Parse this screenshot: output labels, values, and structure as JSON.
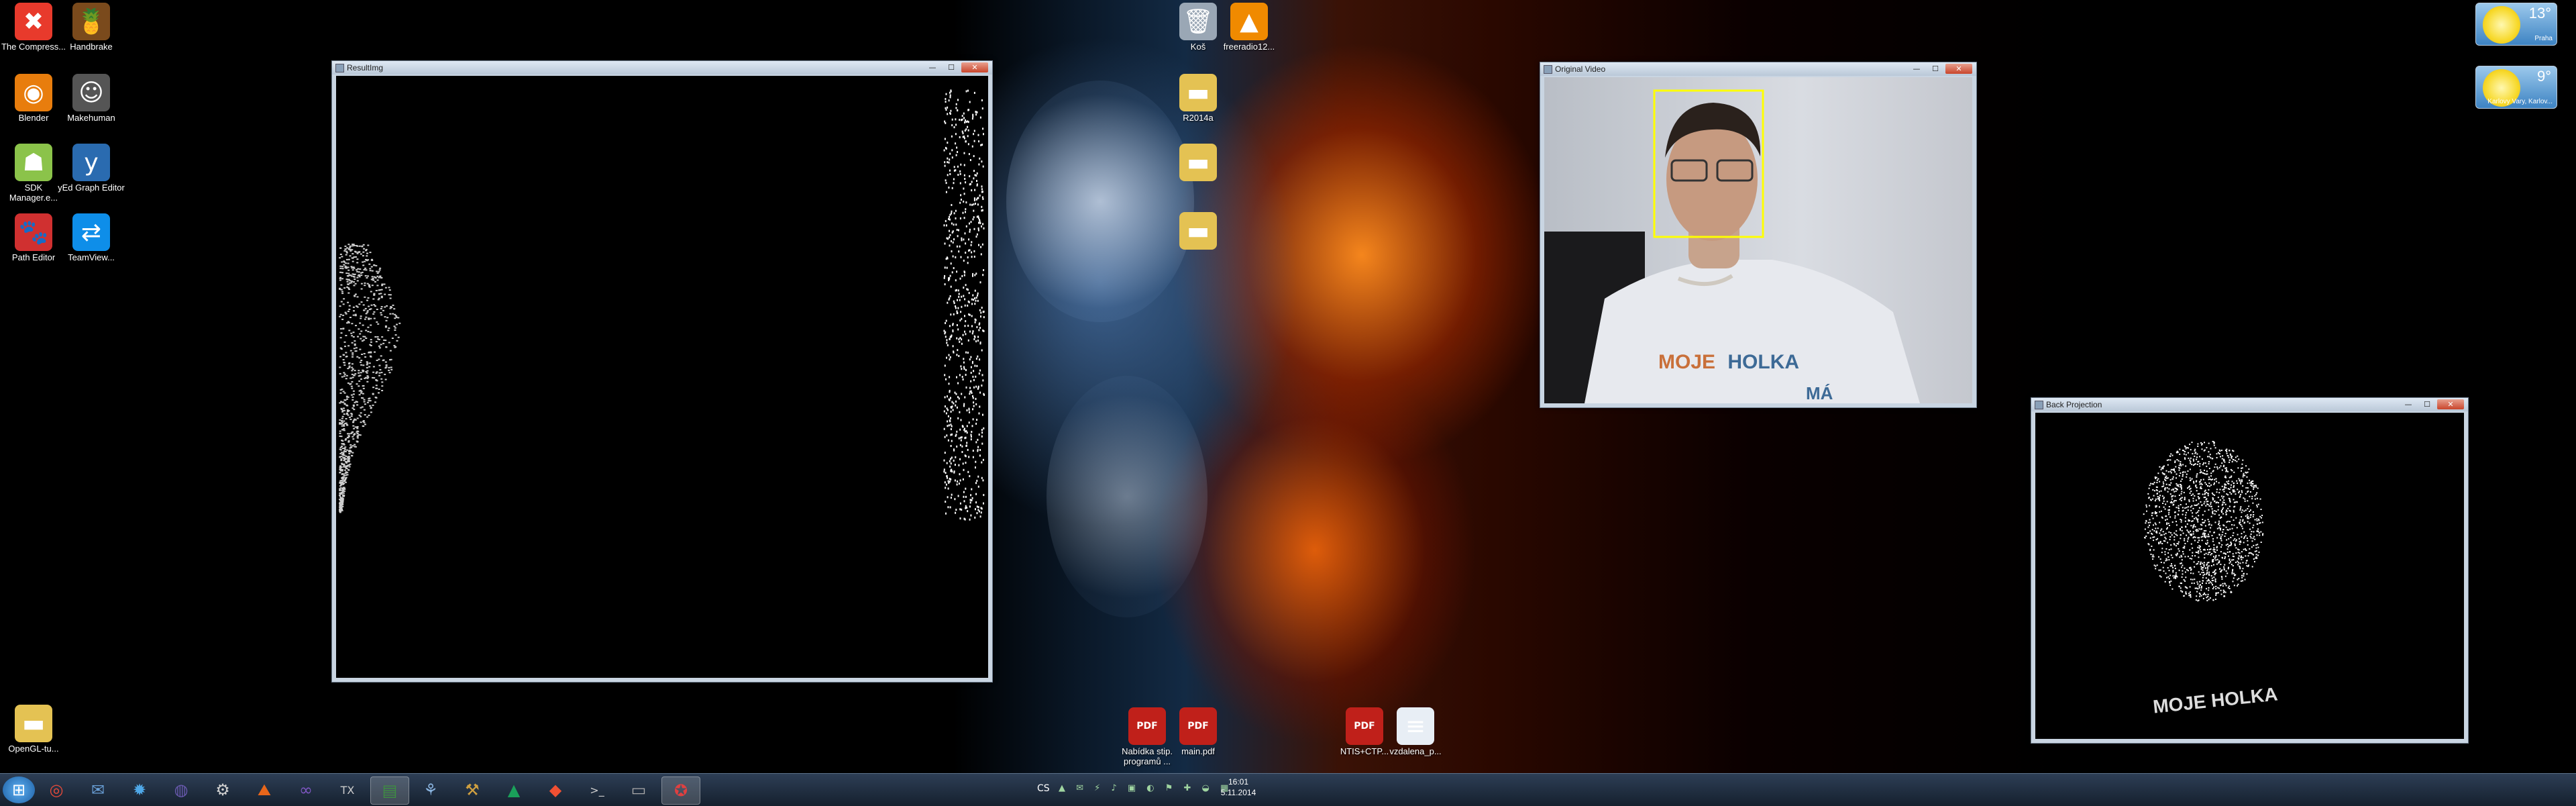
{
  "desktop_icons_left": [
    {
      "label": "The Compress...",
      "icon": "compress-icon",
      "color": "#e83a2c",
      "glyph": "✖"
    },
    {
      "label": "Handbrake",
      "icon": "handbrake-icon",
      "color": "#7a4a1c",
      "glyph": "🍍"
    },
    {
      "label": "Blender",
      "icon": "blender-icon",
      "color": "#e87d0d",
      "glyph": "◉"
    },
    {
      "label": "Makehuman",
      "icon": "makehuman-icon",
      "color": "#555555",
      "glyph": "☺"
    },
    {
      "label": "SDK Manager.e...",
      "icon": "android-sdk-icon",
      "color": "#8bc34a",
      "glyph": "☗"
    },
    {
      "label": "yEd Graph Editor",
      "icon": "yed-icon",
      "color": "#2a6bb0",
      "glyph": "y"
    },
    {
      "label": "Path Editor",
      "icon": "path-editor-icon",
      "color": "#d03030",
      "glyph": "🐾"
    },
    {
      "label": "TeamView...",
      "icon": "teamviewer-icon",
      "color": "#0e8ee9",
      "glyph": "⇄"
    },
    {
      "label": "OpenGL-tu...",
      "icon": "folder-icon",
      "color": "#e4c253",
      "glyph": "▬"
    }
  ],
  "desktop_icons_center": [
    {
      "label": "Koš",
      "icon": "recycle-bin-icon",
      "color": "#9aa7b5",
      "glyph": "🗑"
    },
    {
      "label": "freeradio12...",
      "icon": "vlc-icon",
      "color": "#f08a00",
      "glyph": "▲"
    },
    {
      "label": "R2014a",
      "icon": "folder-icon",
      "color": "#e4c253",
      "glyph": "▬"
    },
    {
      "label": "",
      "icon": "folder-icon",
      "color": "#e4c253",
      "glyph": "▬"
    },
    {
      "label": "",
      "icon": "folder-icon",
      "color": "#e4c253",
      "glyph": "▬"
    }
  ],
  "desktop_icons_bottom": [
    {
      "label": "Nabídka stip. programů ...",
      "icon": "pdf-icon",
      "color": "#c0201a",
      "glyph": "PDF"
    },
    {
      "label": "main.pdf",
      "icon": "pdf-icon",
      "color": "#c0201a",
      "glyph": "PDF"
    },
    {
      "label": "NTIS+CTP...",
      "icon": "pdf-icon",
      "color": "#c0201a",
      "glyph": "PDF"
    },
    {
      "label": "vzdalena_p...",
      "icon": "text-file-icon",
      "color": "#e8eef5",
      "glyph": "≡"
    }
  ],
  "windows": {
    "result": {
      "title": "ResultImg"
    },
    "original": {
      "title": "Original Video",
      "overlay_text": [
        "MOJE",
        "HOLKA",
        "MÁ"
      ]
    },
    "backproj": {
      "title": "Back Projection",
      "overlay_text": "MOJE HOLKA"
    }
  },
  "window_buttons": {
    "minimize": "—",
    "maximize": "☐",
    "close": "✕"
  },
  "gadgets": [
    {
      "temp": "13°",
      "city": "Praha"
    },
    {
      "temp": "9°",
      "city": "Karlovy Vary, Karlov..."
    }
  ],
  "taskbar": {
    "start_glyph": "⊞",
    "apps": [
      {
        "icon": "chrome-icon",
        "glyph": "◎",
        "color": "#e44a3a"
      },
      {
        "icon": "email-icon",
        "glyph": "✉",
        "color": "#6aa0d8"
      },
      {
        "icon": "browser-icon",
        "glyph": "✹",
        "color": "#4fa8e8"
      },
      {
        "icon": "eclipse-icon",
        "glyph": "◍",
        "color": "#6a5ab0"
      },
      {
        "icon": "settings-app-icon",
        "glyph": "⚙",
        "color": "#d0d0d0"
      },
      {
        "icon": "matlab-icon",
        "glyph": "⛰",
        "color": "#e8661a"
      },
      {
        "icon": "visual-studio-icon",
        "glyph": "∞",
        "color": "#7e57c2"
      },
      {
        "icon": "tex-icon",
        "glyph": "TX",
        "color": "#cccccc"
      },
      {
        "icon": "terminal-icon",
        "glyph": "▤",
        "color": "#3e8e41"
      },
      {
        "icon": "network-icon",
        "glyph": "⚘",
        "color": "#8ab4e0"
      },
      {
        "icon": "tool-icon",
        "glyph": "⚒",
        "color": "#d0a040"
      },
      {
        "icon": "triangle-app-icon",
        "glyph": "▲",
        "color": "#1aa05a"
      },
      {
        "icon": "git-icon",
        "glyph": "◆",
        "color": "#f05033"
      },
      {
        "icon": "console-icon",
        "glyph": ">_",
        "color": "#cccccc"
      },
      {
        "icon": "window-app-icon",
        "glyph": "▭",
        "color": "#aaaaaa"
      },
      {
        "icon": "opencv-app-icon",
        "glyph": "✪",
        "color": "#e04040"
      }
    ],
    "language": "CS",
    "time": "16:01",
    "date": "5.11.2014"
  }
}
